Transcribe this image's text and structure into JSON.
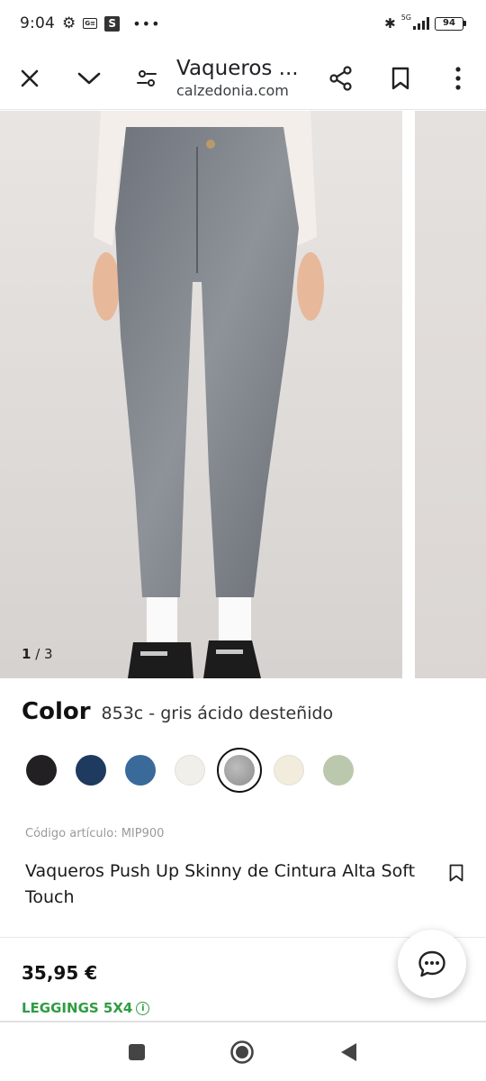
{
  "status_bar": {
    "time": "9:04",
    "network": "5G",
    "battery": "94"
  },
  "toolbar": {
    "title": "Vaqueros ...",
    "url": "calzedonia.com",
    "icons": [
      "close-icon",
      "chevron-down-icon",
      "tune-icon",
      "share-icon",
      "bookmark-icon",
      "more-vert-icon"
    ]
  },
  "gallery": {
    "current": "1",
    "separator": " / ",
    "total": "3"
  },
  "product": {
    "color_label": "Color",
    "color_value": "853c - gris ácido desteñido",
    "swatches": [
      {
        "color": "#222023"
      },
      {
        "color": "#1e3a5f"
      },
      {
        "color": "#3a6a9a"
      },
      {
        "color": "#f1efe9"
      },
      {
        "color": "#a6a6a6",
        "selected": true
      },
      {
        "color": "#f1ecdc"
      },
      {
        "color": "#bcc8ad"
      }
    ],
    "sku": "Código artículo: MIP900",
    "name": "Vaqueros Push Up Skinny de Cintura Alta Soft Touch",
    "price": "35,95 €",
    "promo": "LEGGINGS 5X4"
  },
  "colors": {
    "promo_green": "#2f9c41",
    "text_dark": "#111111"
  }
}
